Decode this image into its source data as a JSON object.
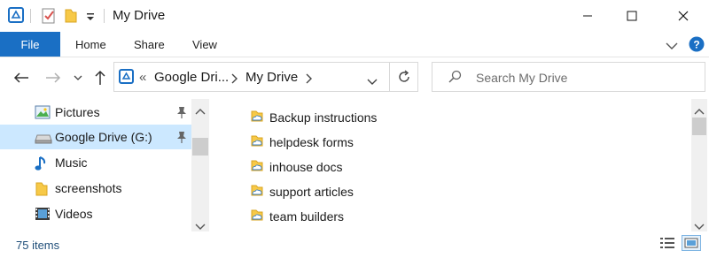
{
  "window": {
    "title": "My Drive",
    "accent": "#1a6fc4"
  },
  "ribbon": {
    "file_label": "File",
    "tabs": [
      "Home",
      "Share",
      "View"
    ]
  },
  "navigation": {
    "breadcrumb_overflow": "«",
    "breadcrumbs": [
      "Google Dri...",
      "My Drive"
    ]
  },
  "search": {
    "placeholder": "Search My Drive"
  },
  "nav_pane": {
    "items": [
      {
        "label": "Pictures",
        "icon": "pictures-icon",
        "pinned": true,
        "selected": false
      },
      {
        "label": "Google Drive (G:)",
        "icon": "drive-icon",
        "pinned": true,
        "selected": true
      },
      {
        "label": "Music",
        "icon": "music-icon",
        "pinned": false,
        "selected": false
      },
      {
        "label": "screenshots",
        "icon": "folder-icon",
        "pinned": false,
        "selected": false
      },
      {
        "label": "Videos",
        "icon": "videos-icon",
        "pinned": false,
        "selected": false
      }
    ]
  },
  "files": [
    {
      "name": "Backup instructions",
      "icon": "cloud-folder-icon"
    },
    {
      "name": "helpdesk forms",
      "icon": "cloud-folder-icon"
    },
    {
      "name": "inhouse docs",
      "icon": "cloud-folder-icon"
    },
    {
      "name": "support articles",
      "icon": "cloud-folder-icon"
    },
    {
      "name": "team builders",
      "icon": "cloud-folder-icon"
    }
  ],
  "status": {
    "item_count": "75 items"
  }
}
